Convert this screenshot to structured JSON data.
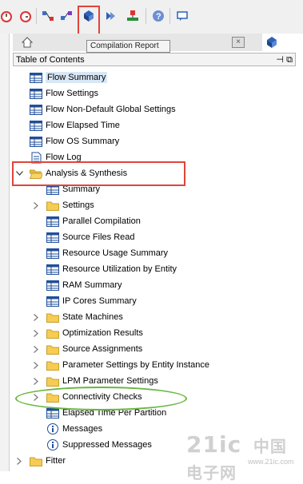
{
  "toolbar": {
    "tooltip": "Compilation Report",
    "colors": {
      "highlight": "#e0443a",
      "annotation": "#6ab63f"
    }
  },
  "panel": {
    "header": "Table of Contents",
    "pin": "⊣",
    "restore": "⧉"
  },
  "tree": {
    "items": [
      {
        "label": "Flow Summary",
        "icon": "table-icon",
        "selected": true
      },
      {
        "label": "Flow Settings",
        "icon": "table-icon"
      },
      {
        "label": "Flow Non-Default Global Settings",
        "icon": "table-icon"
      },
      {
        "label": "Flow Elapsed Time",
        "icon": "table-icon"
      },
      {
        "label": "Flow OS Summary",
        "icon": "table-icon"
      },
      {
        "label": "Flow Log",
        "icon": "document-icon"
      },
      {
        "label": "Analysis & Synthesis",
        "icon": "folder-open-icon",
        "expanded": true
      },
      {
        "label": "Summary",
        "icon": "table-icon"
      },
      {
        "label": "Settings",
        "icon": "folder-icon"
      },
      {
        "label": "Parallel Compilation",
        "icon": "table-icon"
      },
      {
        "label": "Source Files Read",
        "icon": "table-icon"
      },
      {
        "label": "Resource Usage Summary",
        "icon": "table-icon"
      },
      {
        "label": "Resource Utilization by Entity",
        "icon": "table-icon"
      },
      {
        "label": "RAM Summary",
        "icon": "table-icon"
      },
      {
        "label": "IP Cores Summary",
        "icon": "table-icon"
      },
      {
        "label": "State Machines",
        "icon": "folder-icon"
      },
      {
        "label": "Optimization Results",
        "icon": "folder-icon"
      },
      {
        "label": "Source Assignments",
        "icon": "folder-icon"
      },
      {
        "label": "Parameter Settings by Entity Instance",
        "icon": "folder-icon"
      },
      {
        "label": "LPM Parameter Settings",
        "icon": "folder-icon"
      },
      {
        "label": "Connectivity Checks",
        "icon": "folder-icon"
      },
      {
        "label": "Elapsed Time Per Partition",
        "icon": "table-icon"
      },
      {
        "label": "Messages",
        "icon": "info-icon"
      },
      {
        "label": "Suppressed Messages",
        "icon": "info-icon"
      },
      {
        "label": "Fitter",
        "icon": "folder-icon"
      }
    ]
  },
  "watermark": {
    "main": "21ic",
    "cn": "中国电子网",
    "url": "www.21ic.com"
  }
}
